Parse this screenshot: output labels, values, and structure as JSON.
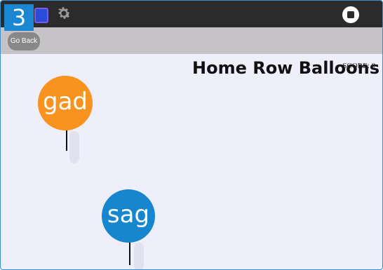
{
  "level": "3",
  "go_back_label": "Go Back",
  "title": "Home Row Balloons",
  "score_text": "SCORE: 0",
  "balloons": [
    {
      "word": "gad",
      "color": "#f7931e"
    },
    {
      "word": "sag",
      "color": "#1687cf"
    }
  ],
  "icons": {
    "app": "app-icon",
    "settings": "gear-icon",
    "stop": "stop-icon"
  }
}
